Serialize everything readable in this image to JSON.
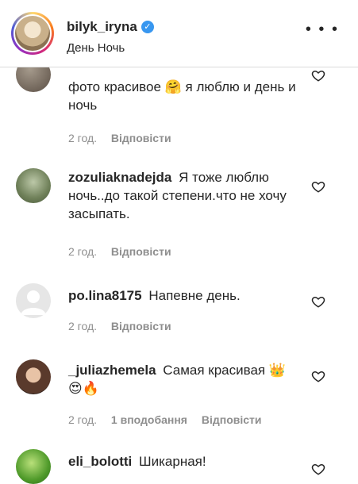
{
  "header": {
    "username": "bilyk_iryna",
    "subtitle": "День Ночь",
    "more_icon": "more-dots-icon",
    "verified_icon": "verified-badge-icon"
  },
  "comments": [
    {
      "username": "",
      "text": "фото красивое 🤗 я люблю и день и ночь",
      "time": "2 год.",
      "likes": "",
      "reply": "Відповісти"
    },
    {
      "username": "zozuliaknadejda",
      "text": "Я тоже люблю ночь..до такой степени.что не хочу засыпать.",
      "time": "2 год.",
      "likes": "",
      "reply": "Відповісти"
    },
    {
      "username": "po.lina8175",
      "text": "Напевне день.",
      "time": "2 год.",
      "likes": "",
      "reply": "Відповісти"
    },
    {
      "username": "_juliazhemela",
      "text": "Самая красивая 👑😍🔥",
      "time": "2 год.",
      "likes": "1 вподобання",
      "reply": "Відповісти"
    },
    {
      "username": "eli_bolotti",
      "text": "Шикарная!",
      "time": "",
      "likes": "",
      "reply": ""
    }
  ],
  "icons": {
    "like": "heart-outline-icon"
  }
}
